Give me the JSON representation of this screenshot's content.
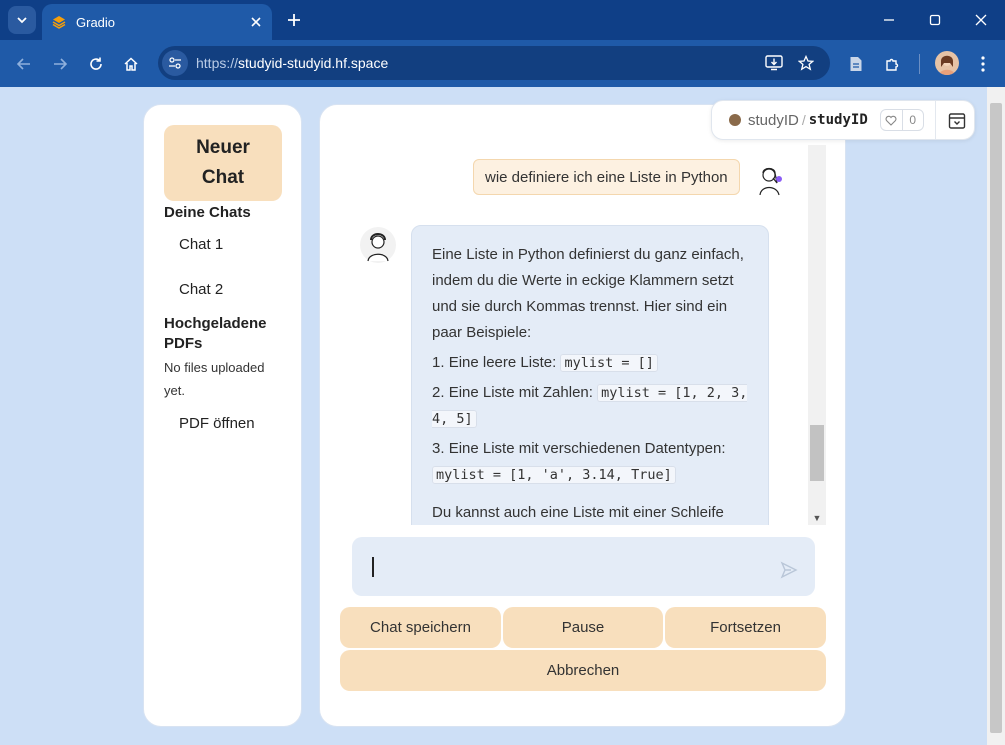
{
  "browser": {
    "tab_title": "Gradio",
    "url_scheme": "https://",
    "url_host": "studyid-studyid.hf.space"
  },
  "sidebar": {
    "new_chat_label": "Neuer Chat",
    "chats_heading": "Deine Chats",
    "chats": [
      "Chat 1",
      "Chat 2"
    ],
    "pdfs_heading": "Hochgeladene PDFs",
    "no_files_text": "No files uploaded yet.",
    "open_pdf_label": "PDF öffnen"
  },
  "chat": {
    "user_message": "wie definiere ich eine Liste in Python",
    "bot_intro": "Eine Liste in Python definierst du ganz einfach, indem du die Werte in eckige Klammern setzt und sie durch Kommas trennst. Hier sind ein paar Beispiele:",
    "items": [
      {
        "num": "1.",
        "text": "Eine leere Liste:",
        "code": "mylist = []"
      },
      {
        "num": "2.",
        "text": "Eine Liste mit Zahlen:",
        "code": "mylist = [1, 2, 3, 4, 5]"
      },
      {
        "num": "3.",
        "text": "Eine Liste mit verschiedenen Datentypen:",
        "code": "mylist = [1, 'a', 3.14, True]"
      }
    ],
    "bot_outro": "Du kannst auch eine Liste mit einer Schleife"
  },
  "input": {
    "value": ""
  },
  "buttons": {
    "save": "Chat speichern",
    "pause": "Pause",
    "resume": "Fortsetzen",
    "abort": "Abbrechen"
  },
  "hf_badge": {
    "owner": "studyID",
    "separator": "/",
    "space": "studyID",
    "likes": "0"
  },
  "colors": {
    "accent": "#f8dfbd",
    "panel": "#e4ecf7",
    "background": "#cddff6",
    "browser_frame": "#1f5aa8"
  }
}
